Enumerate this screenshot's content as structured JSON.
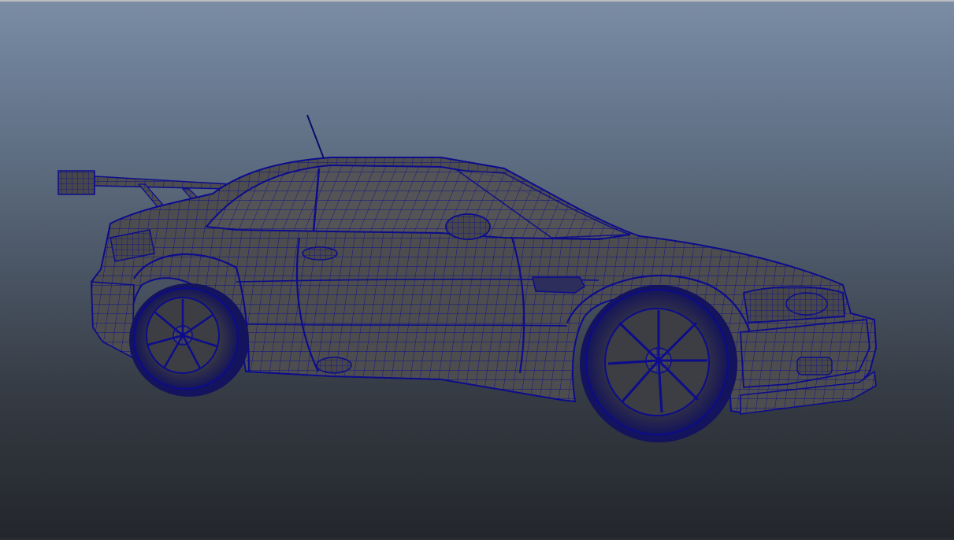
{
  "viewport": {
    "label": "",
    "shading": "wireframe-on-shaded"
  },
  "model": {
    "subject": "car",
    "wire_color": "#0c0c8c",
    "surface_color": "#4d4d4f",
    "tire_color": "#3a3a3e"
  },
  "colors": {
    "background_top": "#7b8ca5",
    "background_bottom": "#23262b",
    "border_top": "#b9bcc0"
  }
}
